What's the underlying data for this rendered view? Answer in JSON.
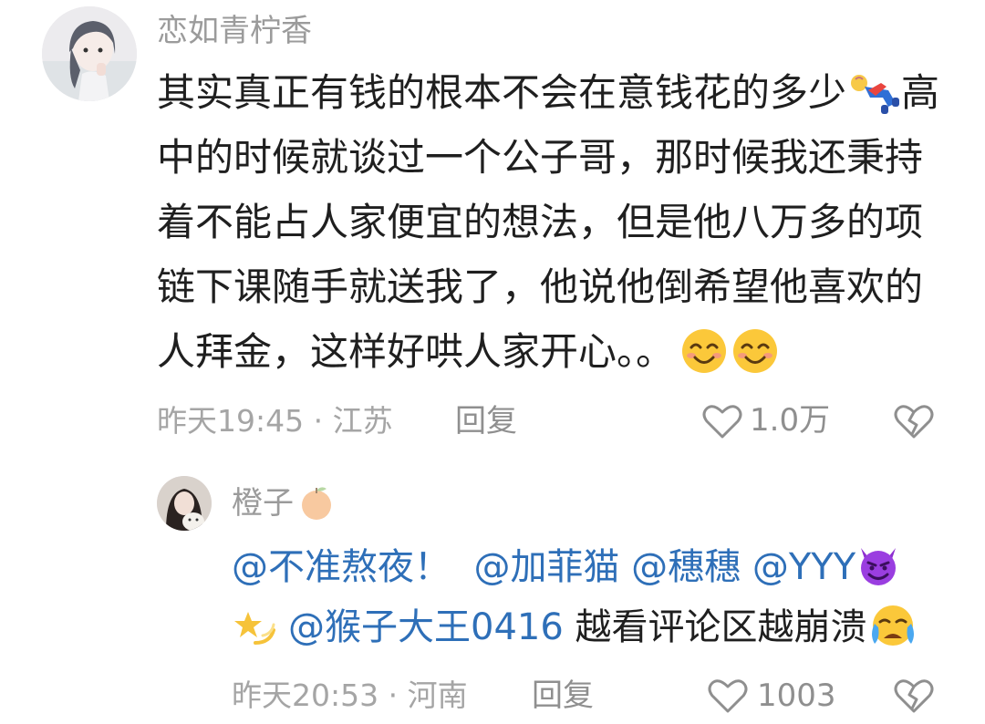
{
  "comment": {
    "username": "恋如青柠香",
    "lines": [
      "其实真正有钱的根本不会在意钱花的多少",
      "高",
      "中的时候就谈过一个公子哥，那时候我还秉持",
      "着不能占人家便宜的想法，但是他八万多的项",
      "链下课随手就送我了，他说他倒希望他喜欢的",
      "人拜金，这样好哄人家开心。。"
    ],
    "meta": "昨天19:45 · 江苏",
    "reply_label": "回复",
    "likes": "1.0万",
    "icons": [
      "fallen-person-emoji",
      "smile-emoji",
      "smile-emoji",
      "heart-outline-icon",
      "broken-heart-icon"
    ]
  },
  "reply": {
    "username": "橙子",
    "mentions": [
      "@不准熬夜！",
      "@加菲猫",
      "@穗穗",
      "@YYY",
      "@猴子大王0416"
    ],
    "text": "越看评论区越崩溃",
    "meta": "昨天20:53 · 河南",
    "reply_label": "回复",
    "likes": "1003",
    "icons": [
      "tangerine-emoji",
      "devil-emoji",
      "dizzy-star-emoji",
      "crying-emoji",
      "heart-outline-icon",
      "broken-heart-icon"
    ]
  },
  "colors": {
    "mention": "#2e6fb8",
    "meta": "#a5a5a5",
    "text": "#1f1f1f"
  }
}
